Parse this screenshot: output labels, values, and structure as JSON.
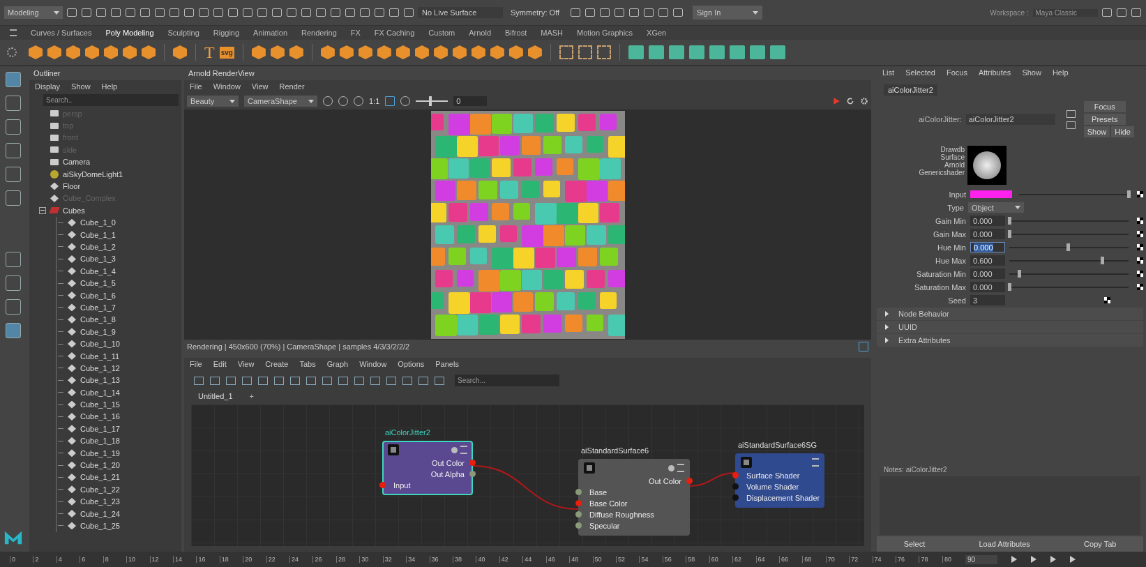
{
  "top_bar": {
    "menu_set": "Modeling",
    "live_surface": "No Live Surface",
    "symmetry": "Symmetry: Off",
    "sign_in": "Sign In",
    "workspace_label": "Workspace :",
    "workspace": "Maya Classic"
  },
  "shelf": {
    "tabs": [
      {
        "label": "Curves / Surfaces",
        "selected": false
      },
      {
        "label": "Poly Modeling",
        "selected": true
      },
      {
        "label": "Sculpting",
        "selected": false
      },
      {
        "label": "Rigging",
        "selected": false
      },
      {
        "label": "Animation",
        "selected": false
      },
      {
        "label": "Rendering",
        "selected": false
      },
      {
        "label": "FX",
        "selected": false
      },
      {
        "label": "FX Caching",
        "selected": false
      },
      {
        "label": "Custom",
        "selected": false
      },
      {
        "label": "Arnold",
        "selected": false
      },
      {
        "label": "Bifrost",
        "selected": false
      },
      {
        "label": "MASH",
        "selected": false
      },
      {
        "label": "Motion Graphics",
        "selected": false
      },
      {
        "label": "XGen",
        "selected": false
      }
    ],
    "text_tool": "T",
    "svg_tool": "svg"
  },
  "outliner": {
    "title": "Outliner",
    "menu": [
      "Display",
      "Show",
      "Help"
    ],
    "search": {
      "placeholder": "Search.."
    },
    "items": [
      {
        "label": "persp",
        "kind": "camera",
        "dimmed": true
      },
      {
        "label": "top",
        "kind": "camera",
        "dimmed": true
      },
      {
        "label": "front",
        "kind": "camera",
        "dimmed": true
      },
      {
        "label": "side",
        "kind": "camera",
        "dimmed": true
      },
      {
        "label": "Camera",
        "kind": "camera",
        "dimmed": false
      },
      {
        "label": "aiSkyDomeLight1",
        "kind": "light",
        "dimmed": false
      },
      {
        "label": "Floor",
        "kind": "mesh",
        "dimmed": false
      },
      {
        "label": "Cube_Complex",
        "kind": "mesh",
        "dimmed": true
      },
      {
        "label": "Cubes",
        "kind": "group",
        "dimmed": false,
        "expanded": true,
        "children": [
          {
            "label": "Cube_1_0",
            "kind": "mesh",
            "dimmed": false
          },
          {
            "label": "Cube_1_1",
            "kind": "mesh",
            "dimmed": false
          },
          {
            "label": "Cube_1_2",
            "kind": "mesh",
            "dimmed": false
          },
          {
            "label": "Cube_1_3",
            "kind": "mesh",
            "dimmed": false
          },
          {
            "label": "Cube_1_4",
            "kind": "mesh",
            "dimmed": false
          },
          {
            "label": "Cube_1_5",
            "kind": "mesh",
            "dimmed": false
          },
          {
            "label": "Cube_1_6",
            "kind": "mesh",
            "dimmed": false
          },
          {
            "label": "Cube_1_7",
            "kind": "mesh",
            "dimmed": false
          },
          {
            "label": "Cube_1_8",
            "kind": "mesh",
            "dimmed": false
          },
          {
            "label": "Cube_1_9",
            "kind": "mesh",
            "dimmed": false
          },
          {
            "label": "Cube_1_10",
            "kind": "mesh",
            "dimmed": false
          },
          {
            "label": "Cube_1_11",
            "kind": "mesh",
            "dimmed": false
          },
          {
            "label": "Cube_1_12",
            "kind": "mesh",
            "dimmed": false
          },
          {
            "label": "Cube_1_13",
            "kind": "mesh",
            "dimmed": false
          },
          {
            "label": "Cube_1_14",
            "kind": "mesh",
            "dimmed": false
          },
          {
            "label": "Cube_1_15",
            "kind": "mesh",
            "dimmed": false
          },
          {
            "label": "Cube_1_16",
            "kind": "mesh",
            "dimmed": false
          },
          {
            "label": "Cube_1_17",
            "kind": "mesh",
            "dimmed": false
          },
          {
            "label": "Cube_1_18",
            "kind": "mesh",
            "dimmed": false
          },
          {
            "label": "Cube_1_19",
            "kind": "mesh",
            "dimmed": false
          },
          {
            "label": "Cube_1_20",
            "kind": "mesh",
            "dimmed": false
          },
          {
            "label": "Cube_1_21",
            "kind": "mesh",
            "dimmed": false
          },
          {
            "label": "Cube_1_22",
            "kind": "mesh",
            "dimmed": false
          },
          {
            "label": "Cube_1_23",
            "kind": "mesh",
            "dimmed": false
          },
          {
            "label": "Cube_1_24",
            "kind": "mesh",
            "dimmed": false
          },
          {
            "label": "Cube_1_25",
            "kind": "mesh",
            "dimmed": false
          }
        ]
      }
    ]
  },
  "render_view": {
    "title": "Arnold RenderView",
    "menu": [
      "File",
      "Window",
      "View",
      "Render"
    ],
    "aov": "Beauty",
    "camera": "CameraShape",
    "ratio": "1:1",
    "exposure": "0",
    "exposure_slider": {
      "level": 0.45
    },
    "status": "Rendering | 450x600 (70%) | CameraShape  | samples 4/3/3/2/2/2"
  },
  "node_editor": {
    "menu": [
      "File",
      "Edit",
      "View",
      "Create",
      "Tabs",
      "Graph",
      "Window",
      "Options",
      "Panels"
    ],
    "search": {
      "placeholder": "Search..."
    },
    "tabs": [
      {
        "label": "Untitled_1",
        "selected": true
      }
    ],
    "add_tab": "+",
    "nodes": [
      {
        "name": "aiColorJitter2",
        "kind": "utility",
        "selected": true,
        "ports": [
          {
            "label": "Out Color",
            "kind": "out",
            "connected": true
          },
          {
            "label": "Out Alpha",
            "kind": "out",
            "connected": false
          },
          {
            "label": "Input",
            "kind": "in",
            "connected": true
          }
        ]
      },
      {
        "name": "aiStandardSurface6",
        "kind": "shader",
        "selected": false,
        "ports": [
          {
            "label": "Out Color",
            "kind": "out",
            "connected": true
          },
          {
            "label": "Base",
            "kind": "in",
            "connected": false
          },
          {
            "label": "Base Color",
            "kind": "in",
            "connected": true
          },
          {
            "label": "Diffuse Roughness",
            "kind": "in",
            "connected": false
          },
          {
            "label": "Specular",
            "kind": "in",
            "connected": false
          }
        ]
      },
      {
        "name": "aiStandardSurface6SG",
        "kind": "shading_group",
        "selected": false,
        "ports": [
          {
            "label": "Surface Shader",
            "kind": "in",
            "connected": true
          },
          {
            "label": "Volume Shader",
            "kind": "in",
            "connected": false
          },
          {
            "label": "Displacement Shader",
            "kind": "in",
            "connected": false
          }
        ]
      }
    ]
  },
  "attribute_editor": {
    "menu": [
      "List",
      "Selected",
      "Focus",
      "Attributes",
      "Show",
      "Help"
    ],
    "tab": "aiColorJitter2",
    "node_type_label": "aiColorJitter:",
    "node_name": "aiColorJitter2",
    "buttons": [
      "Focus",
      "Presets",
      "Show",
      "Hide"
    ],
    "classification": [
      "Drawdb",
      "Surface",
      "Arnold",
      "Genericshader"
    ],
    "input": {
      "label": "Input",
      "color": "#ff22ee",
      "level": 1
    },
    "type": {
      "label": "Type",
      "value": "Object"
    },
    "attributes": [
      {
        "label": "Gain Min",
        "value": "0.000",
        "level": 0,
        "focused": false
      },
      {
        "label": "Gain Max",
        "value": "0.000",
        "level": 0,
        "focused": false
      },
      {
        "label": "Hue Min",
        "value": "0.000",
        "level": 0.49,
        "focused": true
      },
      {
        "label": "Hue Max",
        "value": "0.600",
        "level": 0.78,
        "focused": false
      },
      {
        "label": "Saturation Min",
        "value": "0.000",
        "level": 0.08,
        "focused": false
      },
      {
        "label": "Saturation Max",
        "value": "0.000",
        "level": 0,
        "focused": false
      }
    ],
    "seed": {
      "label": "Seed",
      "value": "3"
    },
    "sections": [
      {
        "label": "Node Behavior",
        "expanded": false
      },
      {
        "label": "UUID",
        "expanded": false
      },
      {
        "label": "Extra Attributes",
        "expanded": false
      }
    ],
    "notes": "Notes:  aiColorJitter2",
    "bottom_buttons": [
      "Select",
      "Load Attributes",
      "Copy Tab"
    ]
  },
  "timeline": {
    "ticks": [
      "0",
      "2",
      "4",
      "6",
      "8",
      "10",
      "12",
      "14",
      "16",
      "18",
      "20",
      "22",
      "24",
      "26",
      "28",
      "30",
      "32",
      "34",
      "36",
      "38",
      "40",
      "42",
      "44",
      "46",
      "48",
      "50",
      "52",
      "54",
      "56",
      "58",
      "60",
      "62",
      "64",
      "66",
      "68",
      "70",
      "72",
      "74",
      "76",
      "78",
      "80"
    ],
    "current_frame": "90"
  }
}
